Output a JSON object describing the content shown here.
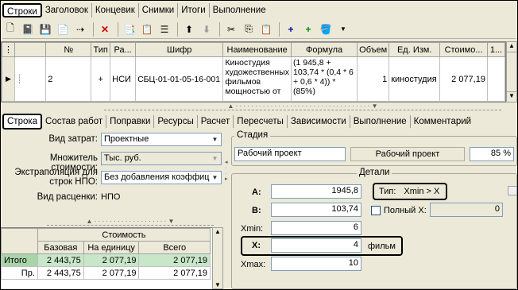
{
  "main_tabs": [
    "Строки",
    "Заголовок",
    "Концевик",
    "Снимки",
    "Итоги",
    "Выполнение"
  ],
  "grid": {
    "headers": [
      "№",
      "Тип",
      "Ра...",
      "Шифр",
      "Наименование",
      "Формула",
      "Объем",
      "Ед. Изм.",
      "Стоимо...",
      "1..."
    ],
    "row": {
      "num": "2",
      "type": "+",
      "ra": "НСИ",
      "code": "СБЦ-01-01-05-16-001",
      "name": "Киностудия художественных фильмов мощностью от",
      "formula": "(1 945,8 + 103,74 * (0,4 * 6 + 0,6 * 4)) * (85%)",
      "volume": "1",
      "unit": "киностудия",
      "cost": "2 077,19"
    }
  },
  "sub_tabs": [
    "Строка",
    "Состав работ",
    "Поправки",
    "Ресурсы",
    "Расчет",
    "Пересчеты",
    "Зависимости",
    "Выполнение",
    "Комментарий"
  ],
  "form": {
    "expense_label": "Вид затрат:",
    "expense_value": "Проектные",
    "mult_label": "Множитель стоимости:",
    "mult_value": "Тыс. руб.",
    "extrap_label": "Экстраполяция для строк НПО:",
    "extrap_value": "Без добавления коэффиц",
    "pricing_label": "Вид расценки:",
    "pricing_value": "НПО"
  },
  "cost_table": {
    "title": "Стоимость",
    "headers": [
      "Базовая",
      "На единицу",
      "Всего"
    ],
    "rows": [
      {
        "label": "Итого",
        "base": "2 443,75",
        "unit": "2 077,19",
        "total": "2 077,19"
      },
      {
        "label": "Пр.",
        "base": "2 443,75",
        "unit": "2 077,19",
        "total": "2 077,19"
      }
    ]
  },
  "stage": {
    "title": "Стадия",
    "input": "Рабочий проект",
    "label": "Рабочий проект",
    "percent": "85 %"
  },
  "details": {
    "title": "Детали",
    "a_label": "A:",
    "a_value": "1945,8",
    "b_label": "B:",
    "b_value": "103,74",
    "xmin_label": "Xmin:",
    "xmin_value": "6",
    "x_label": "X:",
    "x_value": "4",
    "x_unit": "фильм",
    "xmax_label": "Xmax:",
    "xmax_value": "10",
    "type_label": "Тип:",
    "type_value": "Xmin > X",
    "full_x_label": "Полный X:",
    "full_x_value": "0"
  }
}
